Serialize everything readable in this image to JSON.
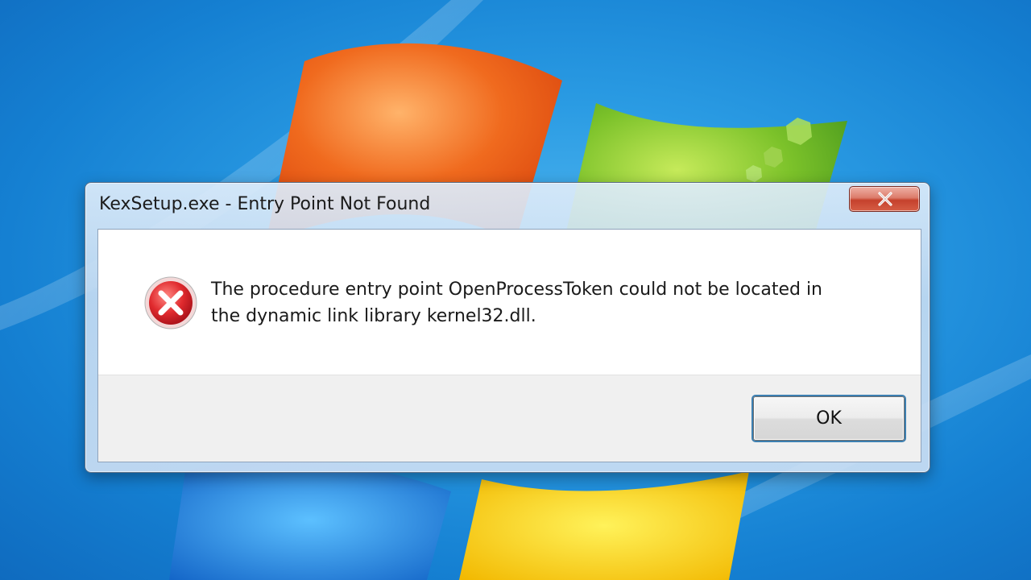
{
  "dialog": {
    "title": "KexSetup.exe - Entry Point Not Found",
    "close_icon": "close-icon",
    "message": "The procedure entry point OpenProcessToken could not be located in\nthe dynamic link library kernel32.dll.",
    "error_icon": "error-icon",
    "ok_label": "OK"
  },
  "colors": {
    "desktop_blue": "#1e8ad9",
    "close_button_red": "#c5412c",
    "error_icon_red": "#d0202a",
    "ok_focus_blue": "#3c7fb1"
  }
}
